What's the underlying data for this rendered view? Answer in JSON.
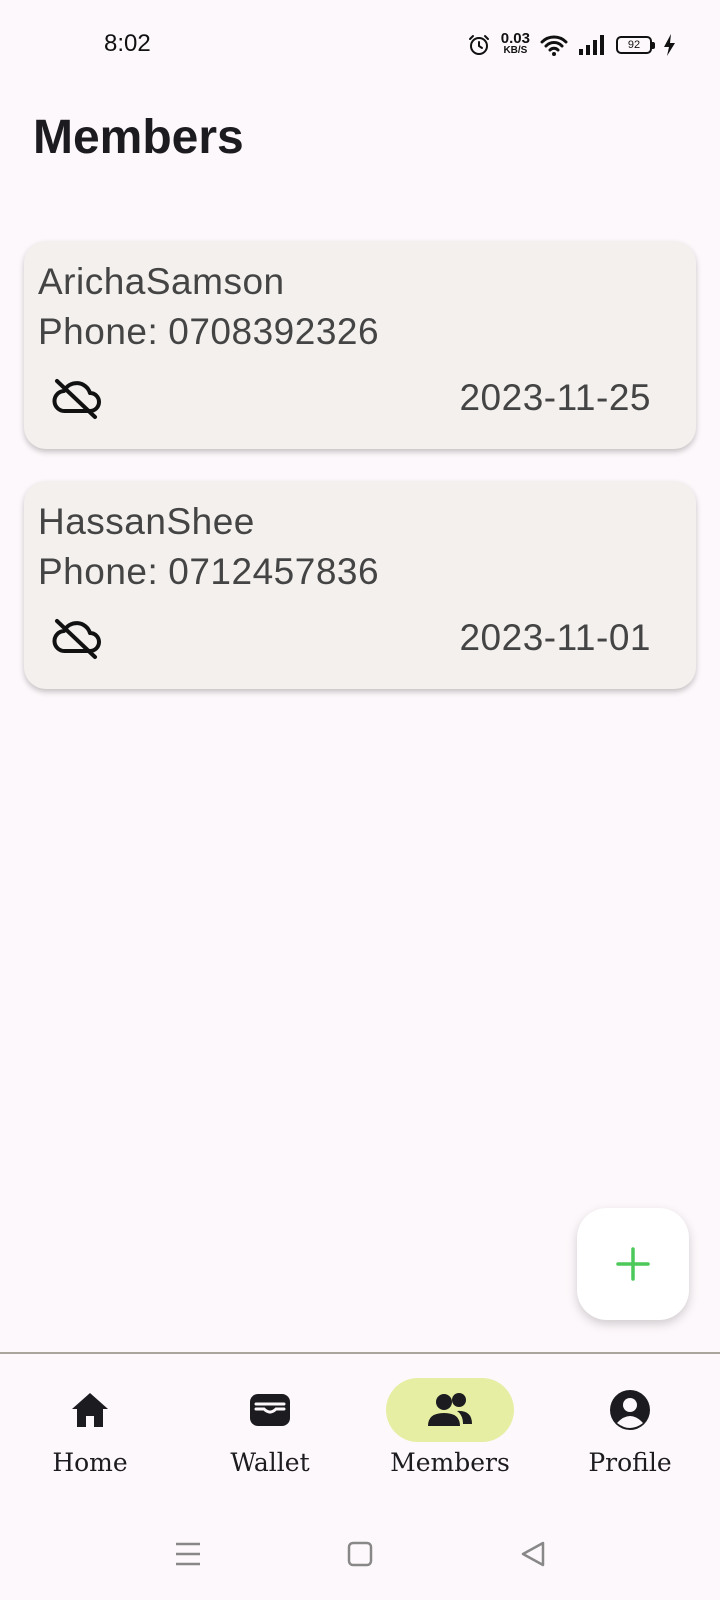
{
  "status_bar": {
    "time": "8:02",
    "net_speed_value": "0.03",
    "net_speed_unit": "KB/S",
    "battery_level": "92"
  },
  "page": {
    "title": "Members"
  },
  "members": [
    {
      "name": "ArichaSamson",
      "phone_label": "Phone:",
      "phone": "0708392326",
      "sync_icon": "cloud-off-icon",
      "date": "2023-11-25"
    },
    {
      "name": "HassanShee",
      "phone_label": "Phone:",
      "phone": "0712457836",
      "sync_icon": "cloud-off-icon",
      "date": "2023-11-01"
    }
  ],
  "fab": {
    "icon": "plus-icon",
    "color": "#4cc95a"
  },
  "bottom_nav": {
    "items": [
      {
        "label": "Home",
        "icon": "home-icon",
        "active": false
      },
      {
        "label": "Wallet",
        "icon": "wallet-icon",
        "active": false
      },
      {
        "label": "Members",
        "icon": "members-icon",
        "active": true
      },
      {
        "label": "Profile",
        "icon": "profile-icon",
        "active": false
      }
    ],
    "active_color": "#e5eea3"
  }
}
